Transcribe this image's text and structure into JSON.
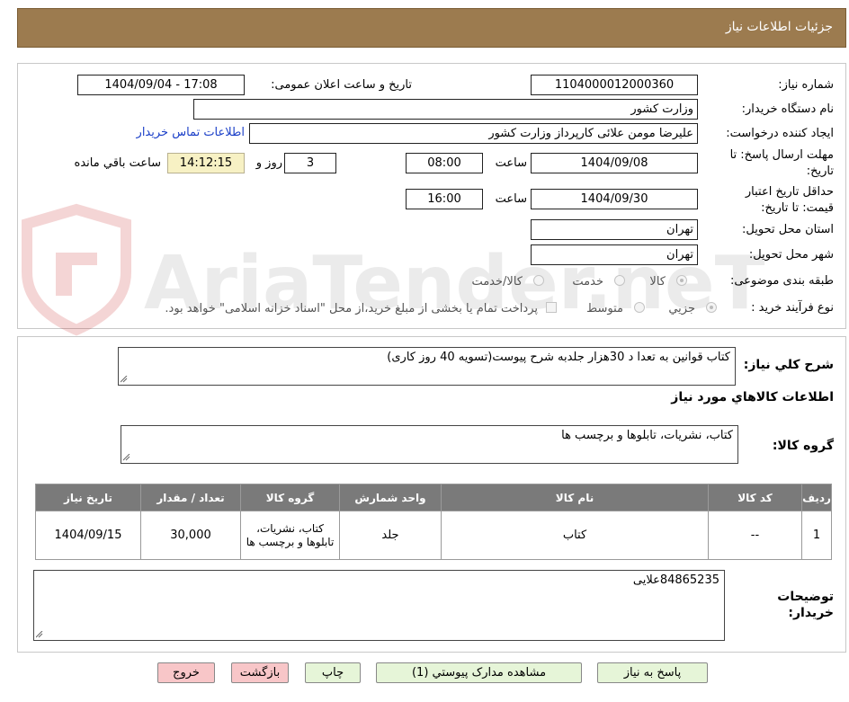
{
  "header": {
    "title": "جزئیات اطلاعات نیاز"
  },
  "form": {
    "need_number_label": "شماره نیاز:",
    "need_number": "1104000012000360",
    "announce_label": "تاریخ و ساعت اعلان عمومی:",
    "announce_value": "1404/09/04 - 17:08",
    "buyer_org_label": "نام دستگاه خریدار:",
    "buyer_org": "وزارت کشور",
    "requester_label": "ایجاد کننده درخواست:",
    "requester": "علیرضا مومن علائی کارپرداز وزارت کشور",
    "contact_link": "اطلاعات تماس خریدار",
    "deadline_label_1": "مهلت ارسال پاسخ: تا",
    "deadline_label_2": "تاریخ:",
    "deadline_date": "1404/09/08",
    "time_label": "ساعت",
    "deadline_time": "08:00",
    "days_value": "3",
    "days_label": "روز و",
    "remaining_time": "14:12:15",
    "remaining_label": "ساعت باقي مانده",
    "validity_label_1": "حداقل تاریخ اعتبار",
    "validity_label_2": "قیمت: تا تاریخ:",
    "validity_date": "1404/09/30",
    "validity_time": "16:00",
    "province_label": "استان محل تحویل:",
    "province": "تهران",
    "city_label": "شهر محل تحویل:",
    "city": "تهران",
    "category_label": "طبقه بندی موضوعی:",
    "category_options": [
      "کالا",
      "خدمت",
      "کالا/خدمت"
    ],
    "category_selected": "کالا",
    "process_label": "نوع فرآیند خرید :",
    "process_options": [
      "جزیي",
      "متوسط"
    ],
    "process_selected": "جزیي",
    "payment_note": "پرداخت تمام یا بخشی از مبلغ خرید،از محل \"اسناد خزانه اسلامی\" خواهد بود."
  },
  "watermark": {
    "text": "AriaTender.neT"
  },
  "description": {
    "label": "شرح کلي نیاز:",
    "text": "کتاب قوانین  به تعدا د 30هزار جلدبه شرح پیوست(تسویه 40 روز کاری)"
  },
  "goods_section": {
    "title": "اطلاعات کالاهاي مورد نیاز"
  },
  "goods_group": {
    "label": "گروه کالا:",
    "value": "کتاب، نشریات، تابلوها و برچسب ها"
  },
  "table": {
    "headers": [
      "ردیف",
      "کد کالا",
      "نام کالا",
      "واحد شمارش",
      "گروه کالا",
      "تعداد / مقدار",
      "تاریخ نیاز"
    ],
    "rows": [
      [
        "1",
        "--",
        "کتاب",
        "جلد",
        "کتاب، نشریات، تابلوها و برچسب ها",
        "30,000",
        "1404/09/15"
      ]
    ]
  },
  "buyer_notes": {
    "label_1": "توضیحات",
    "label_2": "خریدار:",
    "text": "84865235علایی"
  },
  "buttons": {
    "reply": "پاسخ به نیاز",
    "attachments": "مشاهده مدارک پیوستي (1)",
    "print": "چاپ",
    "back": "بازگشت",
    "exit": "خروج"
  }
}
